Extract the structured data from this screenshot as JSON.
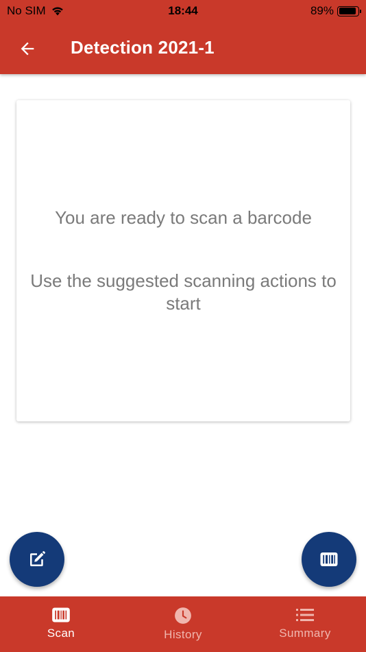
{
  "status_bar": {
    "carrier": "No SIM",
    "time": "18:44",
    "battery": "89%",
    "battery_level": 0.89
  },
  "app_bar": {
    "title": "Detection 2021-1",
    "back_icon": "arrow-left-icon"
  },
  "card": {
    "ready_text": "You are ready to scan a barcode",
    "hint_text": "Use the suggested scanning actions to start"
  },
  "fabs": {
    "left_icon": "edit-icon",
    "right_icon": "barcode-icon"
  },
  "bottom_nav": {
    "tabs": [
      {
        "label": "Scan",
        "icon": "barcode-icon",
        "active": true
      },
      {
        "label": "History",
        "icon": "clock-icon",
        "active": false
      },
      {
        "label": "Summary",
        "icon": "list-icon",
        "active": false
      }
    ]
  },
  "colors": {
    "primary": "#c9392a",
    "fab": "#143a78",
    "text_muted": "#7a7a7a",
    "inactive_tab": "#f0b6ae"
  }
}
